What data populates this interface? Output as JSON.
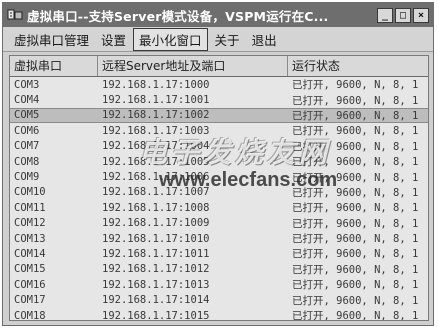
{
  "window": {
    "title": "虚拟串口--支持Server模式设备，VSPM运行在C...",
    "icon": "serial-port-app-icon",
    "controls": {
      "minimize": "_",
      "maximize": "□",
      "close": "×"
    }
  },
  "menu": {
    "items": [
      "虚拟串口管理",
      "设置",
      "最小化窗口",
      "关于",
      "退出"
    ],
    "active_index": 2
  },
  "table": {
    "columns": [
      "虚拟串口",
      "远程Server地址及端口",
      "运行状态"
    ],
    "selected_row": 2,
    "rows": [
      [
        "COM3",
        "192.168.1.17:1000",
        "已打开, 9600, N, 8, 1"
      ],
      [
        "COM4",
        "192.168.1.17:1001",
        "已打开, 9600, N, 8, 1"
      ],
      [
        "COM5",
        "192.168.1.17:1002",
        "已打开, 9600, N, 8, 1"
      ],
      [
        "COM6",
        "192.168.1.17:1003",
        "已打开, 9600, N, 8, 1"
      ],
      [
        "COM7",
        "192.168.1.17:1004",
        "已打开, 9600, N, 8, 1"
      ],
      [
        "COM8",
        "192.168.1.17:1005",
        "已打开, 9600, N, 8, 1"
      ],
      [
        "COM9",
        "192.168.1.17:1006",
        "已打开, 9600, N, 8, 1"
      ],
      [
        "COM10",
        "192.168.1.17:1007",
        "已打开, 9600, N, 8, 1"
      ],
      [
        "COM11",
        "192.168.1.17:1008",
        "已打开, 9600, N, 8, 1"
      ],
      [
        "COM12",
        "192.168.1.17:1009",
        "已打开, 9600, N, 8, 1"
      ],
      [
        "COM13",
        "192.168.1.17:1010",
        "已打开, 9600, N, 8, 1"
      ],
      [
        "COM14",
        "192.168.1.17:1011",
        "已打开, 9600, N, 8, 1"
      ],
      [
        "COM15",
        "192.168.1.17:1012",
        "已打开, 9600, N, 8, 1"
      ],
      [
        "COM16",
        "192.168.1.17:1013",
        "已打开, 9600, N, 8, 1"
      ],
      [
        "COM17",
        "192.168.1.17:1014",
        "已打开, 9600, N, 8, 1"
      ],
      [
        "COM18",
        "192.168.1.17:1015",
        "已打开, 9600, N, 8, 1"
      ]
    ]
  },
  "watermark": {
    "cn": "电子发烧友网",
    "en": "www.elecfans.com"
  }
}
